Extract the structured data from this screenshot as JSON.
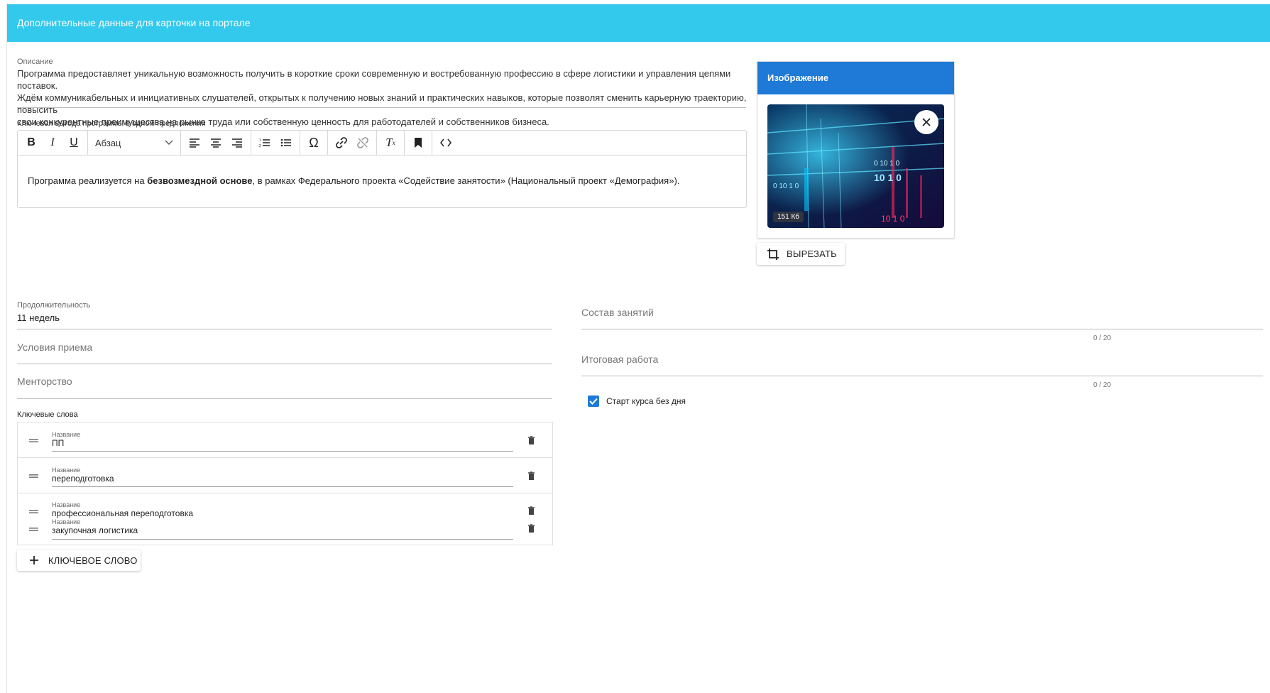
{
  "header": {
    "title": "Дополнительные данные для карточки на портале"
  },
  "description": {
    "label": "Описание",
    "lines": [
      "Программа предоставляет уникальную возможность получить в короткие сроки современную и востребованную профессию в сфере логистики и управления цепями поставок.",
      "Ждём коммуникабельных и инициативных слушателей, открытых к получению новых знаний и практических навыков, которые позволят сменить карьерную траекторию, повысить",
      "свои конкурентные преимущества на рынке труда или собственную ценность для работодателей и собственников бизнеса."
    ]
  },
  "editor": {
    "label": "Ключевая выгода программы в одном предложении",
    "format_select": "Абзац",
    "content_before": "Программа реализуется на ",
    "content_bold": "безвозмездной основе",
    "content_after": ", в рамках Федерального проекта «Содействие занятости» (Национальный проект «Демография»)."
  },
  "image_card": {
    "title": "Изображение",
    "size_badge": "151 Кб",
    "crop_button": "ВЫРЕЗАТЬ"
  },
  "fields": {
    "duration_label": "Продолжительность",
    "duration_value": "11 недель",
    "admission_placeholder": "Условия приема",
    "mentoring_placeholder": "Менторство",
    "composition_placeholder": "Состав занятий",
    "composition_counter": "0 / 20",
    "final_work_placeholder": "Итоговая работа",
    "final_work_counter": "0 / 20"
  },
  "checkbox": {
    "label": "Старт курса без дня",
    "checked": true
  },
  "keywords": {
    "label": "Ключевые слова",
    "items": [
      {
        "sub": "Название",
        "value": "ПП"
      },
      {
        "sub": "Название",
        "value": "переподготовка"
      },
      {
        "sub": "Название",
        "value": "профессиональная переподготовка"
      },
      {
        "sub": "Название",
        "value": "закупочная логистика"
      }
    ],
    "add_button": "КЛЮЧЕВОЕ СЛОВО"
  },
  "colors": {
    "header": "#33c9ec",
    "accent": "#1e7ad6"
  }
}
